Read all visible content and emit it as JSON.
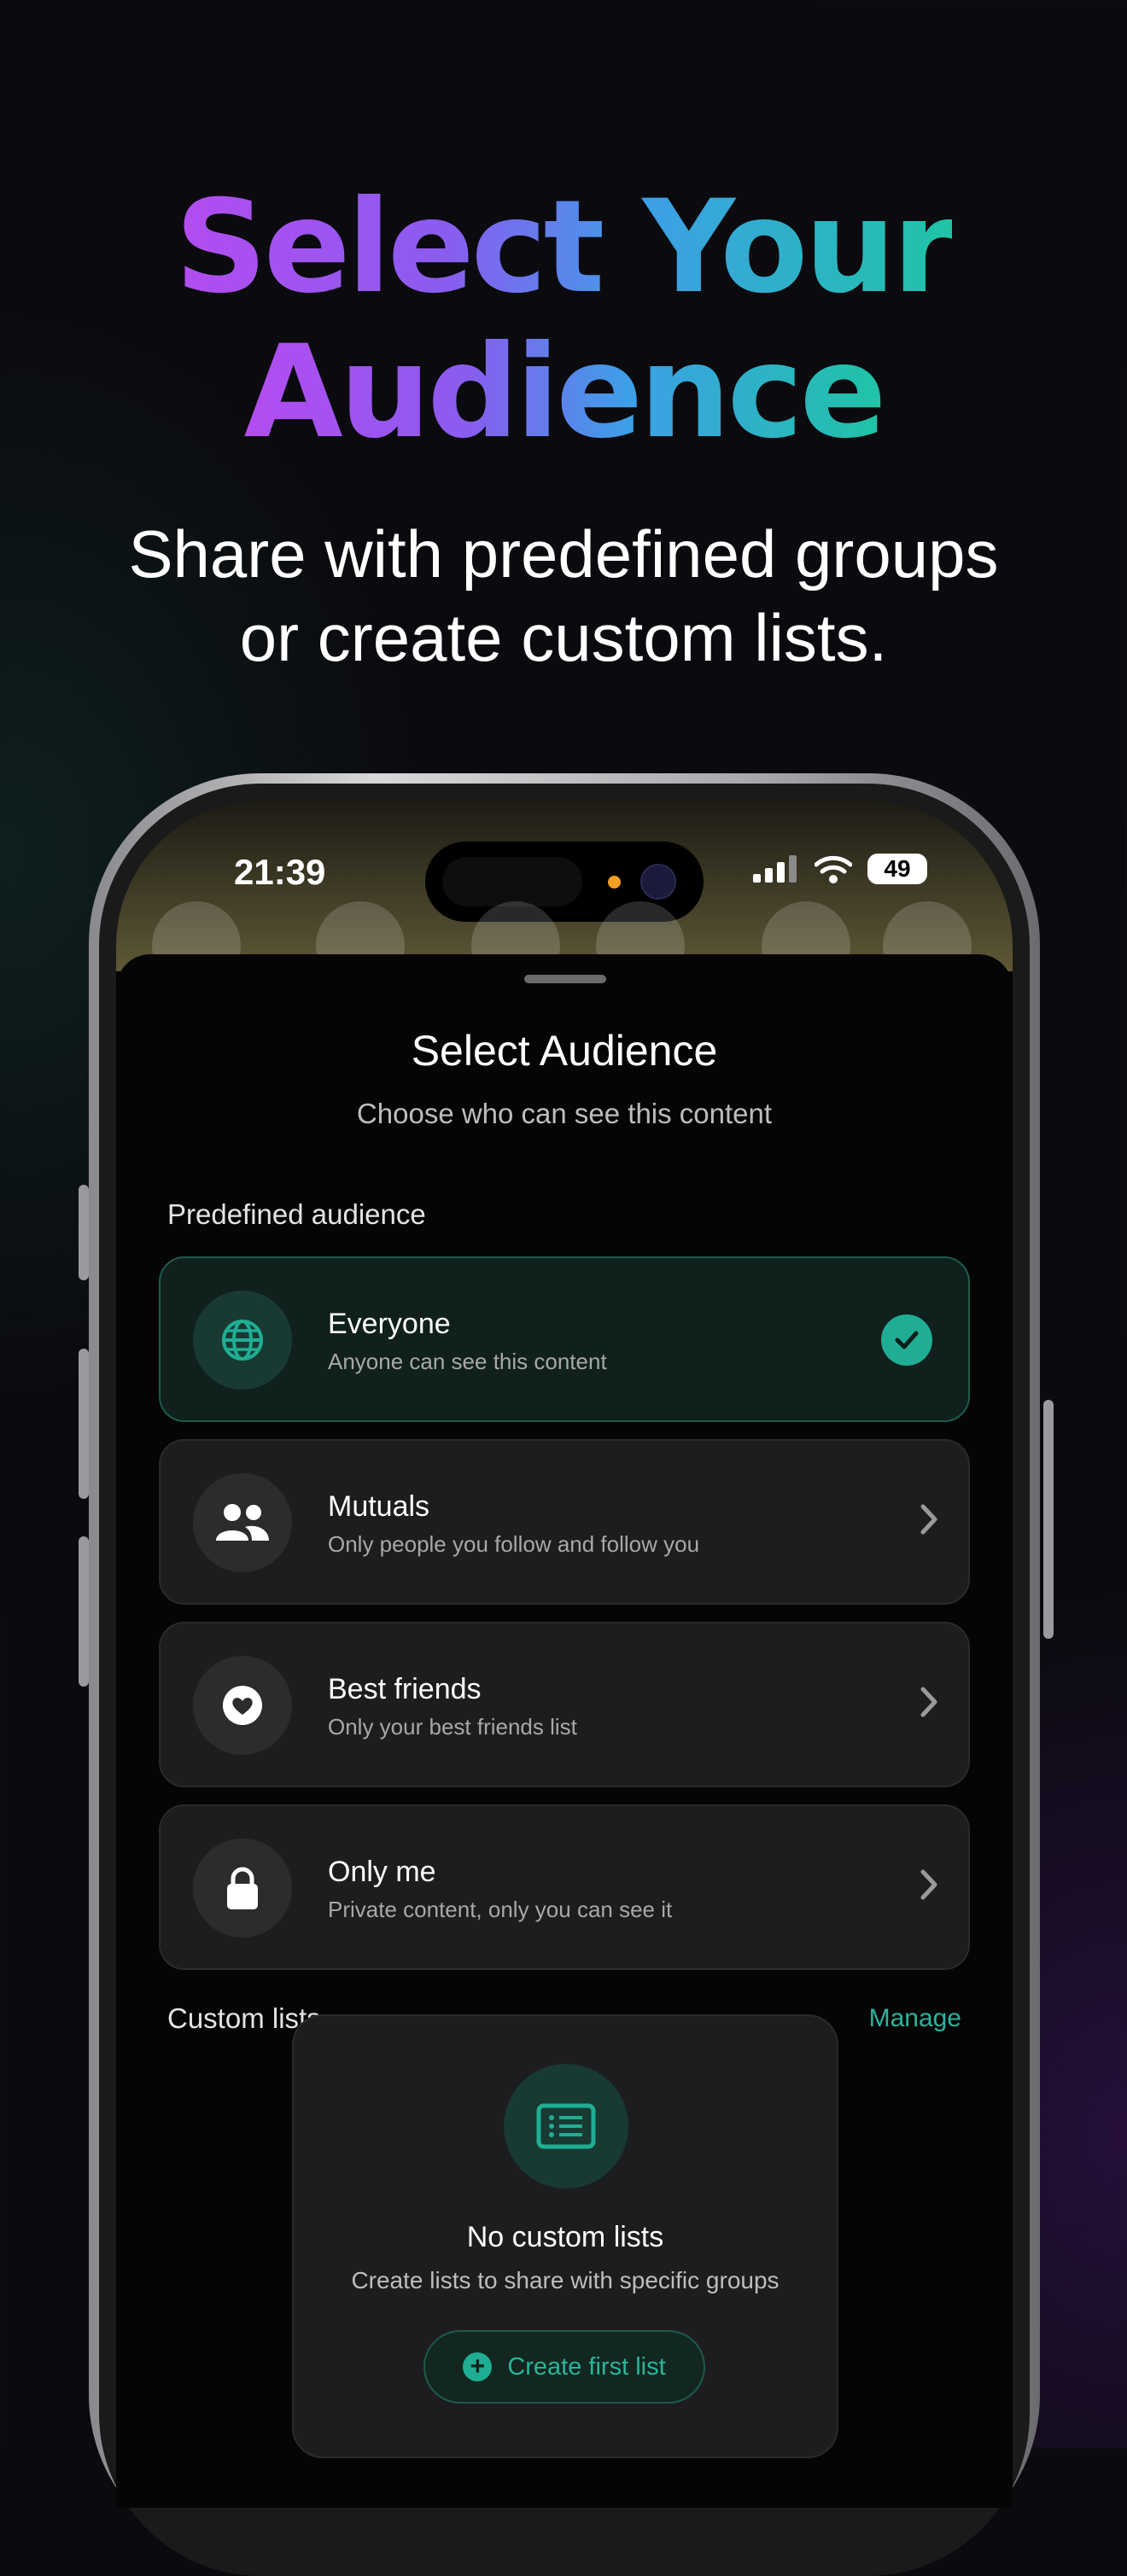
{
  "hero": {
    "title_line1": "Select Your",
    "title_line2": "Audience",
    "subtitle_line1": "Share with predefined groups",
    "subtitle_line2": "or create custom lists."
  },
  "status_bar": {
    "time": "21:39",
    "battery": "49"
  },
  "sheet": {
    "title": "Select Audience",
    "subtitle": "Choose who can see this content",
    "predefined_label": "Predefined audience",
    "options": [
      {
        "title": "Everyone",
        "desc": "Anyone can see this content",
        "icon": "globe-icon",
        "selected": true
      },
      {
        "title": "Mutuals",
        "desc": "Only people you follow and follow you",
        "icon": "people-icon",
        "selected": false
      },
      {
        "title": "Best friends",
        "desc": "Only your best friends list",
        "icon": "heart-icon",
        "selected": false
      },
      {
        "title": "Only me",
        "desc": "Private content, only you can see it",
        "icon": "lock-icon",
        "selected": false
      }
    ],
    "custom_label": "Custom lists",
    "manage_label": "Manage",
    "empty": {
      "title": "No custom lists",
      "desc": "Create lists to share with specific groups",
      "button": "Create first list",
      "icon": "list-icon"
    }
  },
  "colors": {
    "accent": "#1fae93",
    "gradient_start": "#b44cf0",
    "gradient_end": "#1fc4a6"
  }
}
